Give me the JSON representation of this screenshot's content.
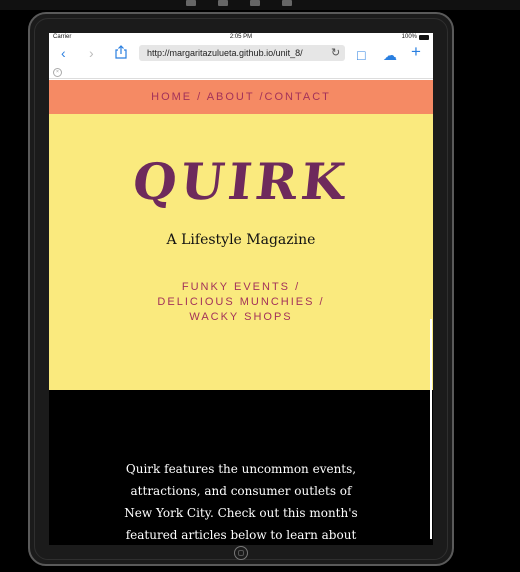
{
  "statusbar": {
    "carrier": "Carrier",
    "time": "2:05 PM",
    "battery": "100%"
  },
  "browser": {
    "url": "http://margaritazulueta.github.io/unit_8/",
    "back_icon": "‹",
    "forward_icon": "›",
    "reload_icon": "↻",
    "book_icon": "□",
    "cloud_icon": "☁",
    "plus_icon": "+",
    "tab_close": "×"
  },
  "site": {
    "nav": {
      "home": "HOME",
      "sep1": " / ",
      "about": "ABOUT",
      "sep2": " /",
      "contact": "CONTACT"
    },
    "logo": "QUIRK",
    "tagline": "A Lifestyle Magazine",
    "links": [
      "FUNKY EVENTS /",
      "DELICIOUS MUNCHIES /",
      "WACKY SHOPS"
    ],
    "intro": "Quirk features the uncommon events, attractions, and consumer outlets of New York City. Check out this month's featured articles below to learn about the quirky"
  },
  "colors": {
    "nav_bg": "#f58a64",
    "hero_bg": "#faea7e",
    "accent": "#a3325a",
    "logo": "#6e2a5c"
  }
}
